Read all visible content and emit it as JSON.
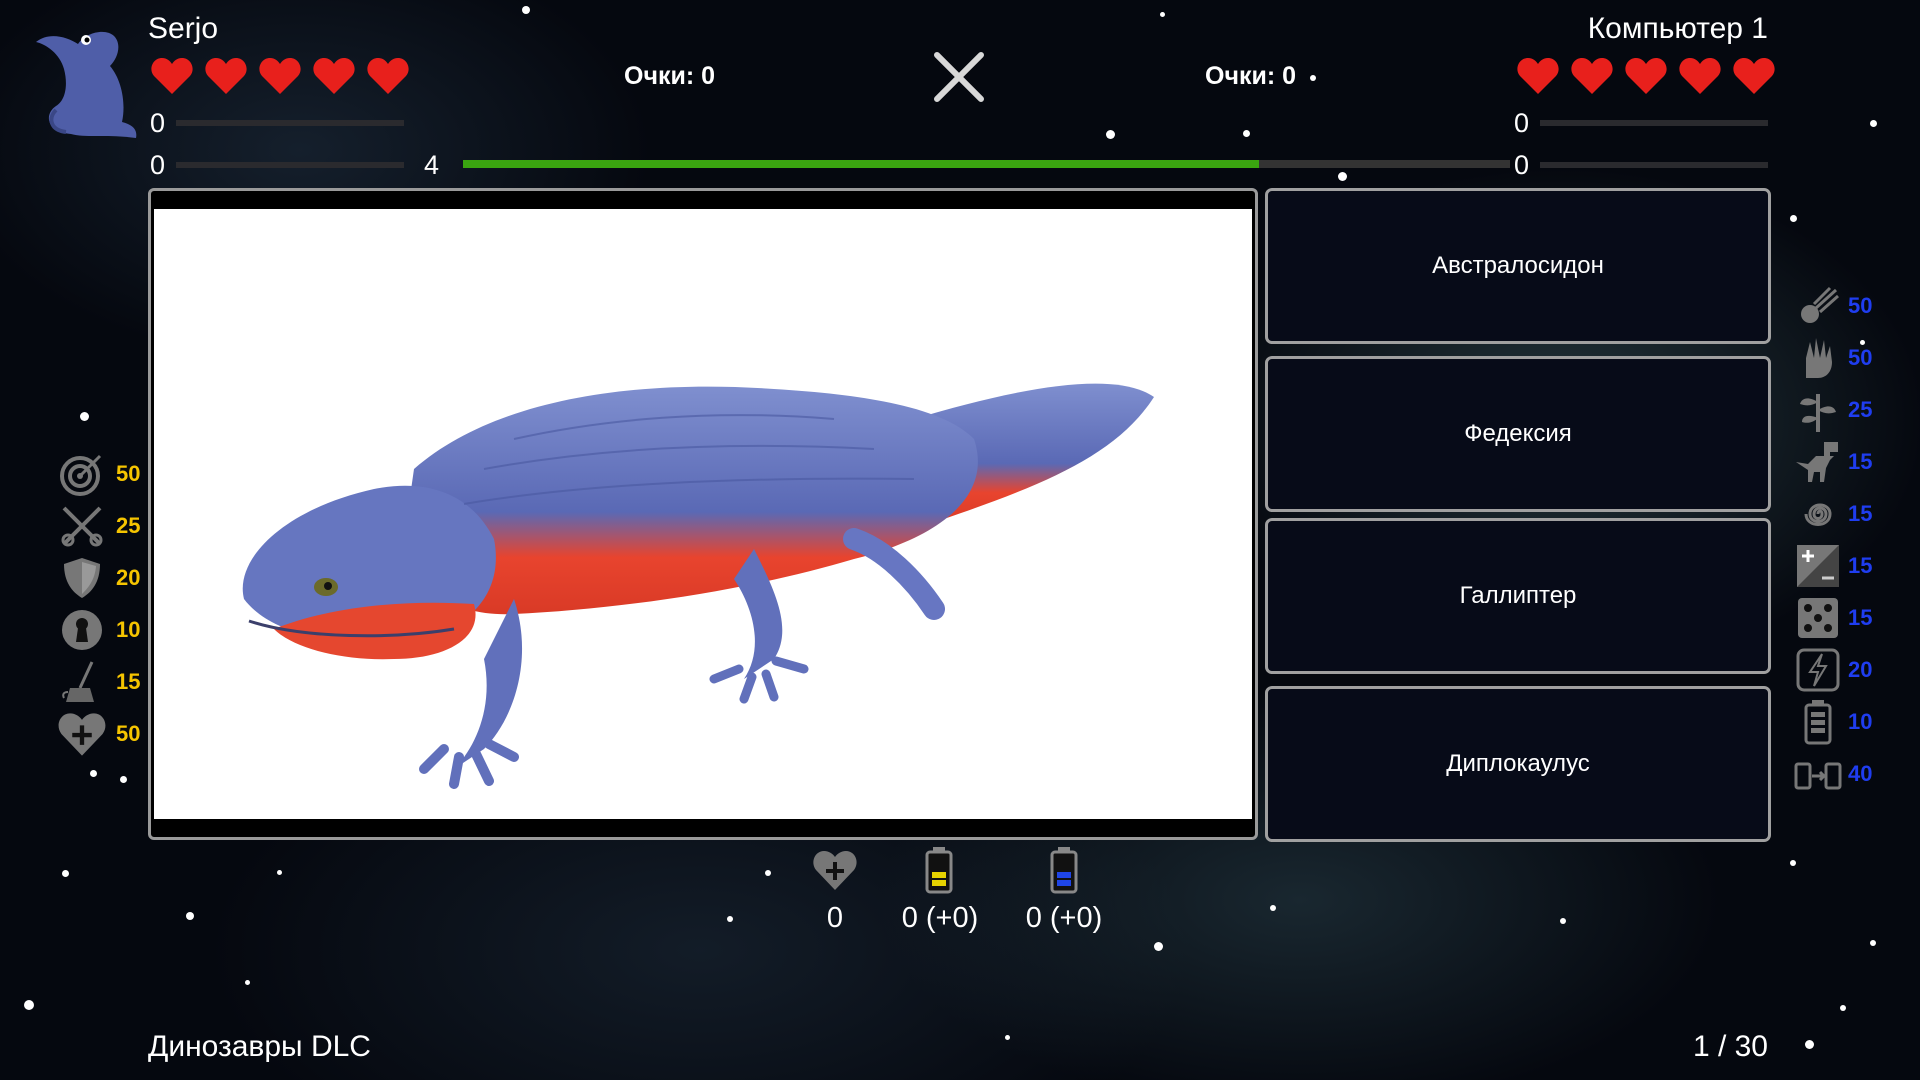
{
  "player": {
    "name": "Serjo",
    "score_label": "Очки: 0",
    "stat_top": "0",
    "stat_bottom": "0"
  },
  "round_counter": "4",
  "timeline_progress": 0.76,
  "opponent": {
    "name": "Компьютер 1",
    "score_label": "Очки: 0",
    "stat_top": "0",
    "stat_bottom": "0"
  },
  "hearts_per_player": 5,
  "answers": [
    "Австралосидон",
    "Федексия",
    "Галлиптер",
    "Диплокаулус"
  ],
  "left_bonuses": [
    {
      "icon": "target-icon",
      "value": "50"
    },
    {
      "icon": "crossed-swords-icon",
      "value": "25"
    },
    {
      "icon": "shield-icon",
      "value": "20"
    },
    {
      "icon": "keyhole-icon",
      "value": "10"
    },
    {
      "icon": "broom-icon",
      "value": "15"
    },
    {
      "icon": "heart-plus-icon",
      "value": "50"
    }
  ],
  "right_bonuses": [
    {
      "icon": "meteor-icon",
      "value": "50"
    },
    {
      "icon": "hand-icon",
      "value": "50"
    },
    {
      "icon": "plant-icon",
      "value": "25"
    },
    {
      "icon": "dinosaur-icon",
      "value": "15"
    },
    {
      "icon": "spiral-icon",
      "value": "15"
    },
    {
      "icon": "plus-minus-icon",
      "value": "15"
    },
    {
      "icon": "dice-icon",
      "value": "15"
    },
    {
      "icon": "lightning-icon",
      "value": "20"
    },
    {
      "icon": "battery-icon",
      "value": "10"
    },
    {
      "icon": "battery-transfer-icon",
      "value": "40"
    }
  ],
  "resources": [
    {
      "icon": "heart-plus-icon",
      "value": "0"
    },
    {
      "icon": "yellow-battery-icon",
      "value": "0 (+0)"
    },
    {
      "icon": "blue-battery-icon",
      "value": "0 (+0)"
    }
  ],
  "footer": {
    "pack_name": "Динозавры DLC",
    "question_counter": "1 / 30"
  },
  "colors": {
    "heart": "#e8201c",
    "timeline": "#3aa410",
    "left_bonus": "#f5c400",
    "right_bonus": "#1f3df0"
  }
}
